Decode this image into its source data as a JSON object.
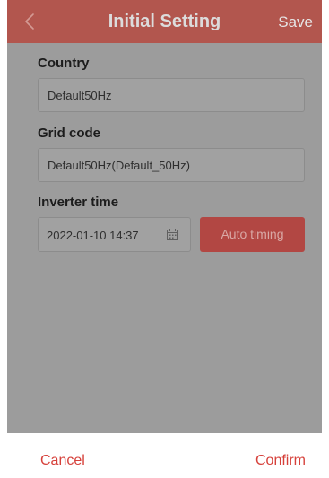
{
  "header": {
    "back_icon": "chevron-left-icon",
    "title": "Initial Setting",
    "save_label": "Save"
  },
  "form": {
    "country": {
      "label": "Country",
      "value": "Default50Hz"
    },
    "grid_code": {
      "label": "Grid code",
      "value": "Default50Hz(Default_50Hz)"
    },
    "inverter_time": {
      "label": "Inverter time",
      "value": "2022-01-10 14:37",
      "calendar_icon": "calendar-icon",
      "auto_timing_label": "Auto timing"
    }
  },
  "footer": {
    "cancel_label": "Cancel",
    "confirm_label": "Confirm"
  },
  "colors": {
    "header_bg": "#b2564e",
    "overlay_bg": "#9c9c9c",
    "button_bg": "#b24743",
    "action_text": "#d6403a"
  }
}
